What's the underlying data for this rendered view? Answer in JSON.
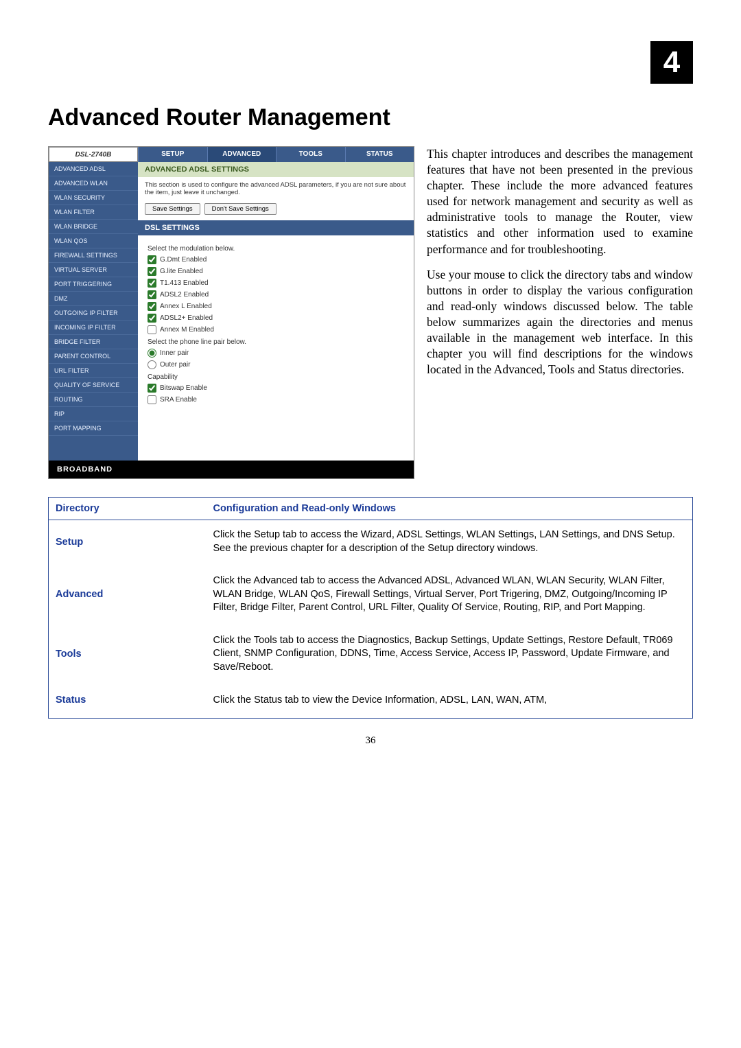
{
  "chapter_number": "4",
  "page_title": "Advanced Router Management",
  "router": {
    "logo": "DSL-2740B",
    "tabs": [
      "SETUP",
      "ADVANCED",
      "TOOLS",
      "STATUS"
    ],
    "active_tab": "ADVANCED",
    "nav": [
      "ADVANCED ADSL",
      "ADVANCED WLAN",
      "WLAN SECURITY",
      "WLAN FILTER",
      "WLAN BRIDGE",
      "WLAN QOS",
      "FIREWALL SETTINGS",
      "VIRTUAL SERVER",
      "PORT TRIGGERING",
      "DMZ",
      "OUTGOING IP FILTER",
      "INCOMING IP FILTER",
      "BRIDGE FILTER",
      "PARENT CONTROL",
      "URL FILTER",
      "QUALITY OF SERVICE",
      "ROUTING",
      "RIP",
      "PORT MAPPING"
    ],
    "adsl_header": "ADVANCED ADSL SETTINGS",
    "adsl_desc": "This section is used to configure the advanced ADSL parameters, if you are not sure about the item, just leave it unchanged.",
    "btn_save": "Save Settings",
    "btn_dont": "Don't Save Settings",
    "dsl_header": "DSL SETTINGS",
    "mod_label": "Select the modulation below.",
    "mods": [
      {
        "label": "G.Dmt Enabled",
        "checked": true
      },
      {
        "label": "G.lite Enabled",
        "checked": true
      },
      {
        "label": "T1.413 Enabled",
        "checked": true
      },
      {
        "label": "ADSL2 Enabled",
        "checked": true
      },
      {
        "label": "Annex L Enabled",
        "checked": true
      },
      {
        "label": "ADSL2+ Enabled",
        "checked": true
      },
      {
        "label": "Annex M Enabled",
        "checked": false
      }
    ],
    "pair_label": "Select the phone line pair below.",
    "pair_inner": "Inner pair",
    "pair_outer": "Outer pair",
    "cap_label": "Capability",
    "cap_bitswap": "Bitswap Enable",
    "cap_sra": "SRA Enable",
    "broadband": "BROADBAND"
  },
  "intro": {
    "p1": "This chapter introduces and describes the management features that have not been presented in the previous chapter. These include the more advanced features used for network management and security as well as administrative tools to manage the Router, view statistics and other information used to examine performance and for troubleshooting.",
    "p2": "Use your mouse to click the directory tabs and window buttons in order to display the various configuration and read-only windows discussed below. The table below summarizes again the directories and menus available in the management web interface. In this chapter you will find descriptions for the windows located in the Advanced, Tools and Status directories."
  },
  "table": {
    "h1": "Directory",
    "h2": "Configuration and Read-only Windows",
    "rows": [
      {
        "dir": "Setup",
        "desc": "Click the Setup tab to access the Wizard, ADSL Settings, WLAN Settings, LAN Settings, and DNS Setup. See the previous chapter for a description of the Setup directory windows."
      },
      {
        "dir": "Advanced",
        "desc": "Click the Advanced tab to access the Advanced ADSL, Advanced WLAN, WLAN Security, WLAN Filter, WLAN Bridge, WLAN QoS, Firewall Settings, Virtual Server, Port Trigering, DMZ, Outgoing/Incoming IP Filter, Bridge Filter, Parent Control, URL Filter, Quality Of Service, Routing, RIP, and Port Mapping."
      },
      {
        "dir": "Tools",
        "desc": "Click the Tools tab to access the Diagnostics, Backup Settings, Update Settings, Restore Default, TR069 Client, SNMP Configuration, DDNS, Time, Access Service, Access IP, Password, Update Firmware, and Save/Reboot."
      },
      {
        "dir": "Status",
        "desc": "Click the Status tab to view the Device Information, ADSL, LAN, WAN, ATM,"
      }
    ]
  },
  "page_number": "36"
}
